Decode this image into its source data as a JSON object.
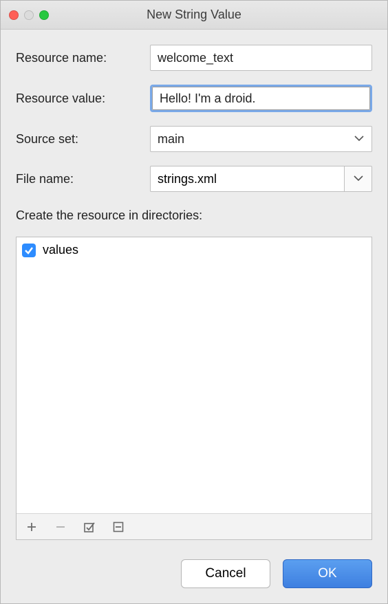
{
  "dialog": {
    "title": "New String Value"
  },
  "fields": {
    "resource_name": {
      "label": "Resource name:",
      "value": "welcome_text"
    },
    "resource_value": {
      "label": "Resource value:",
      "value": "Hello! I'm a droid."
    },
    "source_set": {
      "label": "Source set:",
      "value": "main"
    },
    "file_name": {
      "label": "File name:",
      "value": "strings.xml"
    }
  },
  "directories": {
    "label": "Create the resource in directories:",
    "items": [
      {
        "name": "values",
        "checked": true
      }
    ]
  },
  "buttons": {
    "cancel": "Cancel",
    "ok": "OK"
  }
}
